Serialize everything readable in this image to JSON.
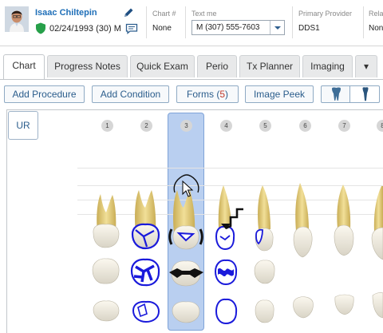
{
  "patient": {
    "name": "Isaac Chiltepin",
    "dob_age": "02/24/1993 (30) M"
  },
  "fields": {
    "chart_label": "Chart #",
    "chart_value": "None",
    "text_me_label": "Text me",
    "text_me_value": "M (307) 555-7603",
    "provider_label": "Primary Provider",
    "provider_value": "DDS1",
    "rel_label": "Rela",
    "rel_value": "Non"
  },
  "tabs": [
    {
      "label": "Chart",
      "active": true
    },
    {
      "label": "Progress Notes"
    },
    {
      "label": "Quick Exam"
    },
    {
      "label": "Perio"
    },
    {
      "label": "Tx Planner"
    },
    {
      "label": "Imaging"
    },
    {
      "label": "▾"
    }
  ],
  "toolbar": {
    "add_procedure": "Add Procedure",
    "add_condition": "Add Condition",
    "forms_label": "Forms",
    "forms_count": "5",
    "image_peek": "Image Peek"
  },
  "chart": {
    "quadrant": "UR",
    "tooth_numbers": [
      "1",
      "2",
      "3",
      "4",
      "5",
      "6",
      "7",
      "8"
    ],
    "selected_tooth": "3"
  },
  "colors": {
    "accent": "#1f6fb8",
    "selection": "#b9cff0",
    "chart_lines": "#1a1adb",
    "tooth_root": "#e8d27a",
    "forms_count": "#c0392b"
  },
  "icons": {
    "edit": "pencil-icon",
    "insurance": "shield-icon",
    "message": "message-icon",
    "dropdown": "chevron-down-icon",
    "view_toggle_a": "tooth-front-icon",
    "view_toggle_b": "tooth-side-icon"
  }
}
